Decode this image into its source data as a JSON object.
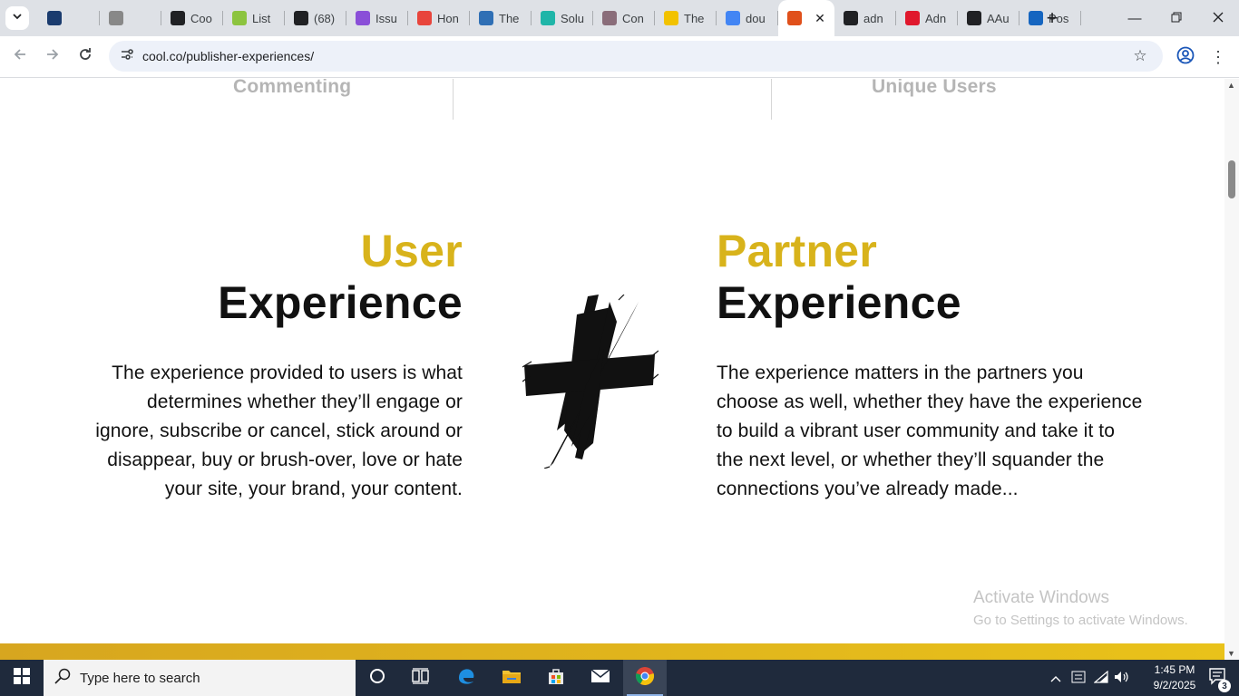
{
  "browser": {
    "tabs": [
      {
        "title": "",
        "favicon": "layers-icon",
        "color": "#1a3b6e"
      },
      {
        "title": "",
        "favicon": "exch-icon",
        "color": "#888888"
      },
      {
        "title": "Coo",
        "favicon": "openai-icon",
        "color": "#202124"
      },
      {
        "title": "List",
        "favicon": "w-icon",
        "color": "#8cc43f"
      },
      {
        "title": "(68)",
        "favicon": "b-icon",
        "color": "#202124"
      },
      {
        "title": "Issu",
        "favicon": "e-icon",
        "color": "#8a4fd8"
      },
      {
        "title": "Hon",
        "favicon": "f-icon",
        "color": "#e8453c"
      },
      {
        "title": "The",
        "favicon": "p-icon",
        "color": "#2f6fb5"
      },
      {
        "title": "Solu",
        "favicon": "swirl-icon",
        "color": "#1fb5a8"
      },
      {
        "title": "Con",
        "favicon": "ring-icon",
        "color": "#8a6d7a"
      },
      {
        "title": "The",
        "favicon": "slash-icon",
        "color": "#f2c200"
      },
      {
        "title": "dou",
        "favicon": "google-icon",
        "color": "#4285f4"
      },
      {
        "title": "",
        "favicon": "c-icon",
        "color": "#e0501b",
        "active": true
      },
      {
        "title": "adn",
        "favicon": "ad-icon",
        "color": "#202124"
      },
      {
        "title": "Adn",
        "favicon": "a-icon",
        "color": "#e0182d"
      },
      {
        "title": "AAu",
        "favicon": "mountain-icon",
        "color": "#202124"
      },
      {
        "title": "Pos",
        "favicon": "xf-icon",
        "color": "#1565c0"
      }
    ],
    "url": "cool.co/publisher-experiences/"
  },
  "page": {
    "stats_labels": [
      "Commenting",
      "Unique Users"
    ],
    "user": {
      "accent": "User",
      "main": "Experience",
      "body": "The experience provided to users is what determines whether they’ll engage or ignore, subscribe or cancel, stick around or disappear, buy or brush-over, love or hate your site, your brand, your content."
    },
    "partner": {
      "accent": "Partner",
      "main": "Experience",
      "body": "The experience matters in the partners you choose as well, whether they have the experience to build a vibrant user community and take it to the next level, or whether they’ll squander the connections you’ve already made..."
    },
    "watermark": {
      "line1": "Activate Windows",
      "line2": "Go to Settings to activate Windows."
    },
    "colors": {
      "accent": "#d8b31b",
      "band": "#e2b71c"
    }
  },
  "taskbar": {
    "search_placeholder": "Type here to search",
    "time": "1:45 PM",
    "date": "9/2/2025",
    "notification_count": "3"
  }
}
